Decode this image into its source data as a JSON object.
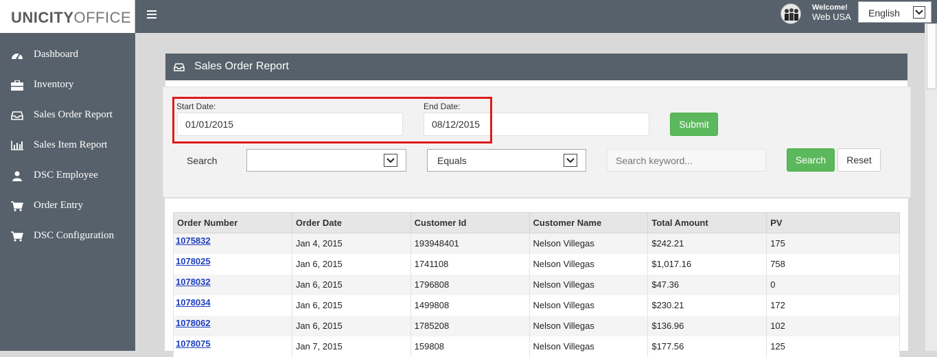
{
  "brand": {
    "bold": "UNICITY",
    "light": "OFFICE"
  },
  "header": {
    "welcome": "Welcome!",
    "username": "Web USA",
    "language": "English"
  },
  "sidebar": {
    "items": [
      {
        "label": "Dashboard",
        "icon": "dashboard-icon"
      },
      {
        "label": "Inventory",
        "icon": "briefcase-icon"
      },
      {
        "label": "Sales Order Report",
        "icon": "inbox-icon"
      },
      {
        "label": "Sales Item Report",
        "icon": "bar-chart-icon"
      },
      {
        "label": "DSC Employee",
        "icon": "user-icon"
      },
      {
        "label": "Order Entry",
        "icon": "cart-icon"
      },
      {
        "label": "DSC Configuration",
        "icon": "cart-icon"
      }
    ]
  },
  "panel": {
    "title": "Sales Order Report"
  },
  "filters": {
    "start_label": "Start Date:",
    "start_value": "01/01/2015",
    "end_label": "End Date:",
    "end_value": "08/12/2015",
    "submit": "Submit",
    "search_label": "Search",
    "search_field": "",
    "operator": "Equals",
    "keyword_placeholder": "Search keyword...",
    "search_button": "Search",
    "reset_button": "Reset"
  },
  "table": {
    "headers": [
      "Order Number",
      "Order Date",
      "Customer Id",
      "Customer Name",
      "Total Amount",
      "PV"
    ],
    "rows": [
      [
        "1075832",
        "Jan 4, 2015",
        "193948401",
        "Nelson Villegas",
        "$242.21",
        "175"
      ],
      [
        "1078025",
        "Jan 6, 2015",
        "1741108",
        "Nelson Villegas",
        "$1,017.16",
        "758"
      ],
      [
        "1078032",
        "Jan 6, 2015",
        "1796808",
        "Nelson Villegas",
        "$47.36",
        "0"
      ],
      [
        "1078034",
        "Jan 6, 2015",
        "1499808",
        "Nelson Villegas",
        "$230.21",
        "172"
      ],
      [
        "1078062",
        "Jan 6, 2015",
        "1785208",
        "Nelson Villegas",
        "$136.96",
        "102"
      ],
      [
        "1078075",
        "Jan 7, 2015",
        "159808",
        "Nelson Villegas",
        "$177.56",
        "125"
      ]
    ]
  },
  "colors": {
    "sidebar": "#56616b",
    "accent_green": "#5cb85c",
    "highlight": "#e01a1a",
    "link": "#1f3fbf"
  }
}
